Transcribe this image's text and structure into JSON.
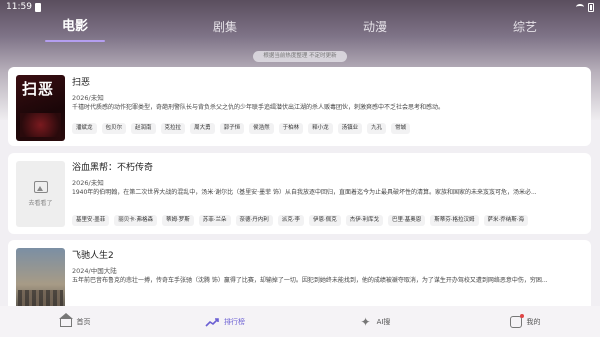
{
  "status": {
    "time": "11:59"
  },
  "tabs": [
    {
      "label": "电影",
      "active": true
    },
    {
      "label": "剧集",
      "active": false
    },
    {
      "label": "动漫",
      "active": false
    },
    {
      "label": "综艺",
      "active": false
    }
  ],
  "notice": "根据当前热度整理 不定时更新",
  "items": [
    {
      "poster_text": "扫恶",
      "title": "扫恶",
      "meta": "2026/未知",
      "description": "千禧时代质感的动作犯罪类型，奇葩刑警队长与背负杀父之仇的少年联手追缉潜伏出江湖的杀人贩毒团伙，刺激爽感中不乏社会思考和感动。",
      "cast": [
        "潘斌龙",
        "包贝尔",
        "赵润南",
        "克拉拉",
        "周大勇",
        "郭子恒",
        "侯浩然",
        "于柏林",
        "释小龙",
        "汤镇业",
        "九孔",
        "常城"
      ]
    },
    {
      "poster_text": "去看看了",
      "title": "浴血黑帮：不朽传奇",
      "meta": "2026/未知",
      "description": "1940年的伯明翰，在第二次世界大战的混乱中，汤米·谢尔比（基里安·墨菲 饰）从自我放逐中回归，直面着迄今为止最具破坏性的清算。家族和国家的未来岌岌可危，汤米必...",
      "cast": [
        "基里安·墨菲",
        "丽贝卡·弗格森",
        "蒂姆·罗斯",
        "苏菲·兰朵",
        "奈德·丹内利",
        "派克·李",
        "伊恩·佩克",
        "杰伊·利库戈",
        "巴里·基奥恩",
        "斯蒂芬·格拉汉姆",
        "萨米·乔纳斯·海"
      ]
    },
    {
      "poster_text": "",
      "title": "飞驰人生2",
      "meta": "2024/中国大陆",
      "description": "五年前巴音布鲁克的悲壮一搏，传奇车手张驰（沈腾 饰）赢得了比赛，却输掉了一切。因犯到她终未能找到，他的成绩被褫夺取消，为了谋生开办驾校又遭到网络恶意中伤，穷困..."
    }
  ],
  "bottom_nav": [
    {
      "label": "首页",
      "icon": "home-icon",
      "active": false
    },
    {
      "label": "排行榜",
      "icon": "trend-icon",
      "active": true
    },
    {
      "label": "AI搜",
      "icon": "sparkle-icon",
      "active": false
    },
    {
      "label": "我的",
      "icon": "profile-icon",
      "active": false
    }
  ],
  "colors": {
    "accent": "#6b5fd3",
    "badge": "#e04545"
  }
}
